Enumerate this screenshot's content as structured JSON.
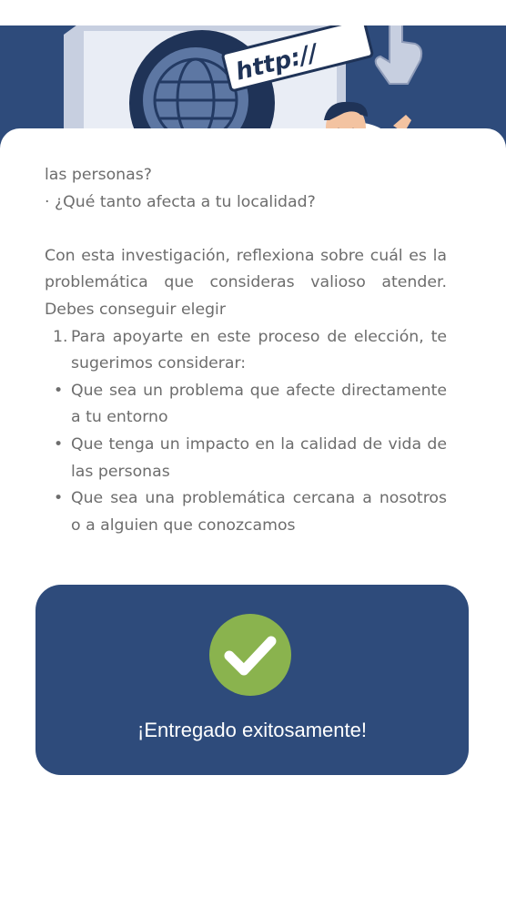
{
  "hero": {
    "url_text": "http://",
    "illustration_icon": "globe-icon",
    "pointer_icon": "hand-cursor-icon"
  },
  "content": {
    "intro_line": "las personas?",
    "question_line": "· ¿Qué tanto afecta a tu localidad?",
    "paragraph": "Con esta investigación, reflexiona sobre cuál es la problemática que consideras valioso atender. Debes conseguir elegir",
    "numbered_item": {
      "marker": "1.",
      "text": "Para apoyarte en este proceso de elección, te sugerimos considerar:"
    },
    "bullets": [
      {
        "marker": "•",
        "text": "Que sea un problema que afecte directamente a tu entorno"
      },
      {
        "marker": "•",
        "text": "Que tenga un impacto en la calidad de vida de las personas"
      },
      {
        "marker": "•",
        "text": "Que sea una problemática cercana a nosotros o a alguien que conozcamos"
      }
    ]
  },
  "success": {
    "icon": "checkmark-icon",
    "message": "¡Entregado exitosamente!"
  },
  "colors": {
    "primary_blue": "#2e4b7b",
    "success_green": "#8ab34e",
    "body_text": "#6d6d6d",
    "background": "#ffffff"
  }
}
